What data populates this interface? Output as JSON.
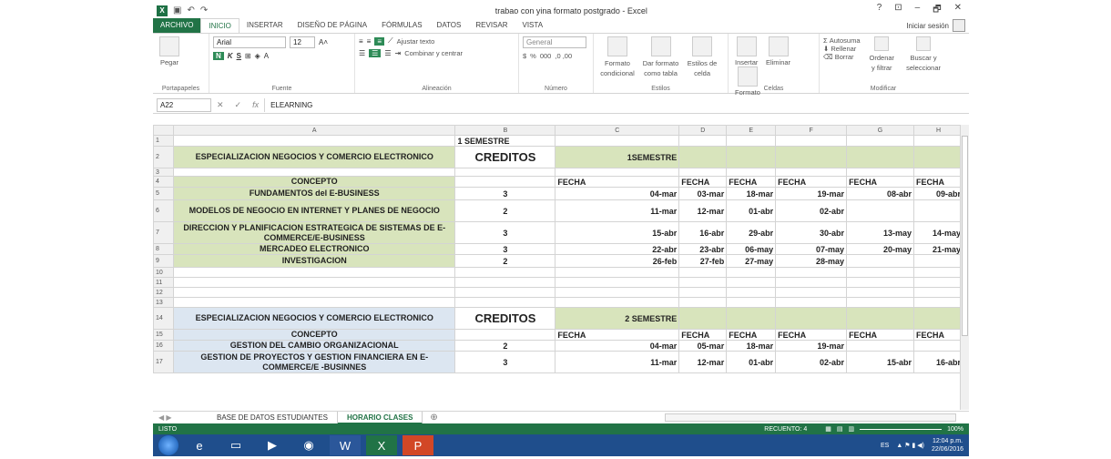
{
  "window": {
    "title": "trabao con yina formato postgrado - Excel",
    "sign_in": "Iniciar sesión",
    "controls": [
      "?",
      "⊡",
      "–",
      "🗗",
      "✕"
    ]
  },
  "ribbon_tabs": [
    "ARCHIVO",
    "INICIO",
    "INSERTAR",
    "DISEÑO DE PÁGINA",
    "FÓRMULAS",
    "DATOS",
    "REVISAR",
    "VISTA"
  ],
  "ribbon": {
    "clipboard": {
      "paste": "Pegar",
      "label": "Portapapeles"
    },
    "font": {
      "name": "Arial",
      "size": "12",
      "bold": "N",
      "italic": "K",
      "underline": "S",
      "label": "Fuente"
    },
    "alignment": {
      "wrap": "Ajustar texto",
      "merge": "Combinar y centrar",
      "label": "Alineación"
    },
    "number": {
      "format": "General",
      "currency": "$",
      "percent": "%",
      "thousands": "000",
      "label": "Número"
    },
    "styles": {
      "conditional": "Formato condicional",
      "as_table": "Dar formato como tabla",
      "cell_styles": "Estilos de celda",
      "label": "Estilos"
    },
    "cells": {
      "insert": "Insertar",
      "delete": "Eliminar",
      "format": "Formato",
      "label": "Celdas"
    },
    "editing": {
      "autosum": "Autosuma",
      "fill": "Rellenar",
      "clear": "Borrar",
      "sort": "Ordenar y filtrar",
      "find": "Buscar y seleccionar",
      "label": "Modificar"
    }
  },
  "formula_bar": {
    "name_box": "A22",
    "fx": "fx",
    "value": "ELEARNING"
  },
  "columns": [
    "A",
    "B",
    "C",
    "D",
    "E",
    "F",
    "G",
    "H"
  ],
  "rows": [
    {
      "n": "1",
      "A": "",
      "B": "1 SEMESTRE",
      "C": "",
      "D": "",
      "E": "",
      "F": "",
      "G": "",
      "H": ""
    },
    {
      "n": "2",
      "A": "ESPECIALIZACION NEGOCIOS Y COMERCIO ELECTRONICO",
      "B": "CREDITOS",
      "C": "1SEMESTRE",
      "D": "",
      "E": "",
      "F": "",
      "G": "",
      "H": ""
    },
    {
      "n": "3",
      "A": "",
      "B": "",
      "C": "",
      "D": "",
      "E": "",
      "F": "",
      "G": "",
      "H": ""
    },
    {
      "n": "4",
      "A": "CONCEPTO",
      "B": "",
      "C": "FECHA",
      "D": "FECHA",
      "E": "FECHA",
      "F": "FECHA",
      "G": "FECHA",
      "H": "FECHA"
    },
    {
      "n": "5",
      "A": "FUNDAMENTOS del E-BUSINESS",
      "B": "3",
      "C": "04-mar",
      "D": "03-mar",
      "E": "18-mar",
      "F": "19-mar",
      "G": "08-abr",
      "H": "09-abr"
    },
    {
      "n": "6",
      "A": "MODELOS DE NEGOCIO EN INTERNET Y PLANES DE NEGOCIO",
      "B": "2",
      "C": "11-mar",
      "D": "12-mar",
      "E": "01-abr",
      "F": "02-abr",
      "G": "",
      "H": ""
    },
    {
      "n": "7",
      "A": "DIRECCION Y PLANIFICACION ESTRATEGICA DE SISTEMAS DE E-COMMERCE/E-BUSINESS",
      "B": "3",
      "C": "15-abr",
      "D": "16-abr",
      "E": "29-abr",
      "F": "30-abr",
      "G": "13-may",
      "H": "14-may"
    },
    {
      "n": "8",
      "A": "MERCADEO ELECTRONICO",
      "B": "3",
      "C": "22-abr",
      "D": "23-abr",
      "E": "06-may",
      "F": "07-may",
      "G": "20-may",
      "H": "21-may"
    },
    {
      "n": "9",
      "A": "INVESTIGACION",
      "B": "2",
      "C": "26-feb",
      "D": "27-feb",
      "E": "27-may",
      "F": "28-may",
      "G": "",
      "H": ""
    },
    {
      "n": "10",
      "A": "",
      "B": "",
      "C": "",
      "D": "",
      "E": "",
      "F": "",
      "G": "",
      "H": ""
    },
    {
      "n": "11",
      "A": "",
      "B": "",
      "C": "",
      "D": "",
      "E": "",
      "F": "",
      "G": "",
      "H": ""
    },
    {
      "n": "12",
      "A": "",
      "B": "",
      "C": "",
      "D": "",
      "E": "",
      "F": "",
      "G": "",
      "H": ""
    },
    {
      "n": "13",
      "A": "",
      "B": "",
      "C": "",
      "D": "",
      "E": "",
      "F": "",
      "G": "",
      "H": ""
    },
    {
      "n": "14",
      "A": "ESPECIALIZACION NEGOCIOS Y COMERCIO ELECTRONICO",
      "B": "CREDITOS",
      "C": "2 SEMESTRE",
      "D": "",
      "E": "",
      "F": "",
      "G": "",
      "H": ""
    },
    {
      "n": "15",
      "A": "CONCEPTO",
      "B": "",
      "C": "FECHA",
      "D": "FECHA",
      "E": "FECHA",
      "F": "FECHA",
      "G": "FECHA",
      "H": "FECHA"
    },
    {
      "n": "16",
      "A": "GESTION DEL CAMBIO ORGANIZACIONAL",
      "B": "2",
      "C": "04-mar",
      "D": "05-mar",
      "E": "18-mar",
      "F": "19-mar",
      "G": "",
      "H": ""
    },
    {
      "n": "17",
      "A": "GESTION DE PROYECTOS Y GESTION FINANCIERA EN E-COMMERCE/E -BUSINNES",
      "B": "3",
      "C": "11-mar",
      "D": "12-mar",
      "E": "01-abr",
      "F": "02-abr",
      "G": "15-abr",
      "H": "16-abr"
    }
  ],
  "sheets": [
    "BASE DE DATOS ESTUDIANTES",
    "HORARIO CLASES"
  ],
  "status": {
    "ready": "LISTO",
    "count": "RECUENTO: 4",
    "zoom": "100%"
  },
  "taskbar": {
    "lang": "ES",
    "time": "12:04 p.m.",
    "date": "22/06/2016"
  },
  "colors": {
    "excel_green": "#217346",
    "green_fill": "#d8e4bc",
    "blue_fill": "#dce6f1",
    "taskbar": "#1f4e8c"
  }
}
